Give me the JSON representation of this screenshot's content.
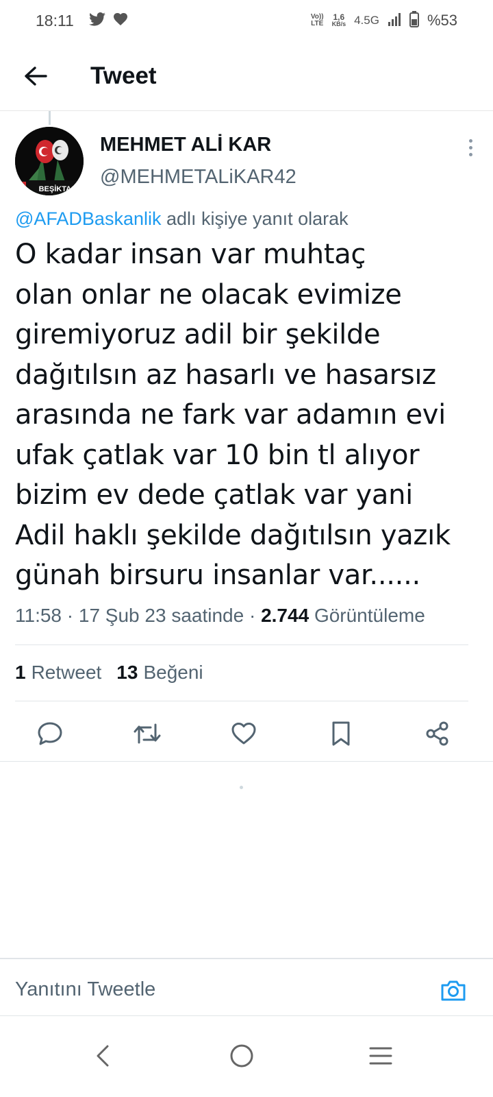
{
  "status_bar": {
    "time": "18:11",
    "left_icons": [
      "twitter-icon",
      "heart-icon"
    ],
    "volte": "Vo)) LTE",
    "volte_top": "Vo))",
    "volte_bottom": "LTE",
    "speed_value": "1,6",
    "speed_unit": "KB/s",
    "network": "4.5G",
    "battery": "%53"
  },
  "header": {
    "back_icon": "arrow-left-icon",
    "title": "Tweet"
  },
  "tweet": {
    "author_name": "MEHMET ALİ KAR",
    "author_handle": "@MEHMETALiKAR42",
    "avatar_text": "BEŞİKTAŞ",
    "reply_mention": "@AFADBaskanlik",
    "reply_suffix": "adlı kişiye yanıt olarak",
    "text_lines": [
      "O kadar insan var muhtaç",
      "olan onlar ne olacak evimize",
      "giremiyoruz adil bir şekilde",
      "dağıtılsın az hasarlı ve hasarsız",
      "arasında ne fark var adamın evi",
      "ufak çatlak var 10 bin tl alıyor",
      "bizim ev dede çatlak var yani",
      "Adil haklı şekilde dağıtılsın yazık",
      "günah birsuru insanlar var......"
    ],
    "meta_time": "11:58 · 17 Şub 23 saatinde ·",
    "views_count": "2.744",
    "views_label": "Görüntüleme",
    "retweet_count": "1",
    "retweet_label": "Retweet",
    "like_count": "13",
    "like_label": "Beğeni"
  },
  "actions": [
    "reply-icon",
    "retweet-icon",
    "like-icon",
    "bookmark-icon",
    "share-icon"
  ],
  "reply_bar": {
    "placeholder": "Yanıtını Tweetle",
    "camera_icon": "camera-icon"
  },
  "nav_bar": [
    "nav-back-icon",
    "nav-home-icon",
    "nav-menu-icon"
  ],
  "colors": {
    "accent": "#1d9bf0",
    "text": "#0f1419",
    "secondary": "#536471"
  }
}
